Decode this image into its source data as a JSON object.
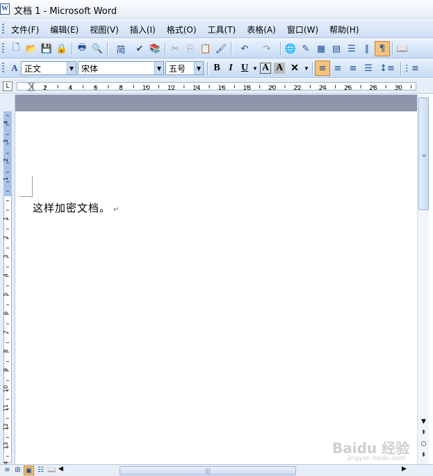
{
  "window": {
    "title": "文档 1 - Microsoft Word",
    "app_icon": "word-doc-icon"
  },
  "menu": {
    "items": [
      {
        "label": "文件(F)"
      },
      {
        "label": "编辑(E)"
      },
      {
        "label": "视图(V)"
      },
      {
        "label": "插入(I)"
      },
      {
        "label": "格式(O)"
      },
      {
        "label": "工具(T)"
      },
      {
        "label": "表格(A)"
      },
      {
        "label": "窗口(W)"
      },
      {
        "label": "帮助(H)"
      }
    ]
  },
  "standard_toolbar": {
    "buttons": [
      {
        "icon": "new-document-icon",
        "glyph": "🗋"
      },
      {
        "icon": "open-folder-icon",
        "glyph": "📂"
      },
      {
        "icon": "save-icon",
        "glyph": "💾"
      },
      {
        "icon": "permission-icon",
        "glyph": "🔒"
      },
      {
        "icon": "print-icon",
        "glyph": "🖶"
      },
      {
        "icon": "print-preview-icon",
        "glyph": "🔍"
      },
      {
        "icon": "traditional-chinese-icon",
        "glyph": "简"
      },
      {
        "icon": "spelling-icon",
        "glyph": "✔"
      },
      {
        "icon": "research-icon",
        "glyph": "📚"
      },
      {
        "icon": "cut-icon",
        "glyph": "✂"
      },
      {
        "icon": "copy-icon",
        "glyph": "⎘"
      },
      {
        "icon": "paste-icon",
        "glyph": "📋"
      },
      {
        "icon": "format-painter-icon",
        "glyph": "🖌"
      },
      {
        "icon": "undo-icon",
        "glyph": "↶"
      },
      {
        "icon": "redo-icon",
        "glyph": "↷"
      },
      {
        "icon": "hyperlink-icon",
        "glyph": "🌐"
      },
      {
        "icon": "tables-borders-icon",
        "glyph": "✎"
      },
      {
        "icon": "insert-table-icon",
        "glyph": "▦"
      },
      {
        "icon": "insert-excel-icon",
        "glyph": "▤"
      },
      {
        "icon": "columns-icon",
        "glyph": "☰"
      },
      {
        "icon": "drawing-icon",
        "glyph": "∥"
      },
      {
        "icon": "show-hide-icon",
        "glyph": "¶"
      },
      {
        "icon": "read-icon",
        "glyph": "📖"
      }
    ]
  },
  "formatting_toolbar": {
    "style_value": "正文",
    "font_value": "宋体",
    "size_value": "五号",
    "bold_label": "B",
    "italic_label": "I",
    "underline_label": "U",
    "char_border_label": "A",
    "char_shading_label": "A",
    "align_active": "left"
  },
  "document": {
    "text": "这样加密文档。",
    "para_mark": "↵"
  },
  "ruler": {
    "h_labels": [
      "2",
      "4",
      "6",
      "8",
      "10",
      "12",
      "14",
      "16",
      "18",
      "20",
      "22",
      "24",
      "26",
      "28",
      "30"
    ],
    "v_top_labels": [
      "4",
      "3",
      "2",
      "1"
    ],
    "v_labels": [
      "1",
      "2",
      "3",
      "4",
      "5",
      "6",
      "7",
      "8",
      "9",
      "10",
      "11",
      "12",
      "13",
      "14"
    ]
  },
  "watermark": {
    "text": "Baidu 经验",
    "sub": "jingyan.baidu.com"
  }
}
